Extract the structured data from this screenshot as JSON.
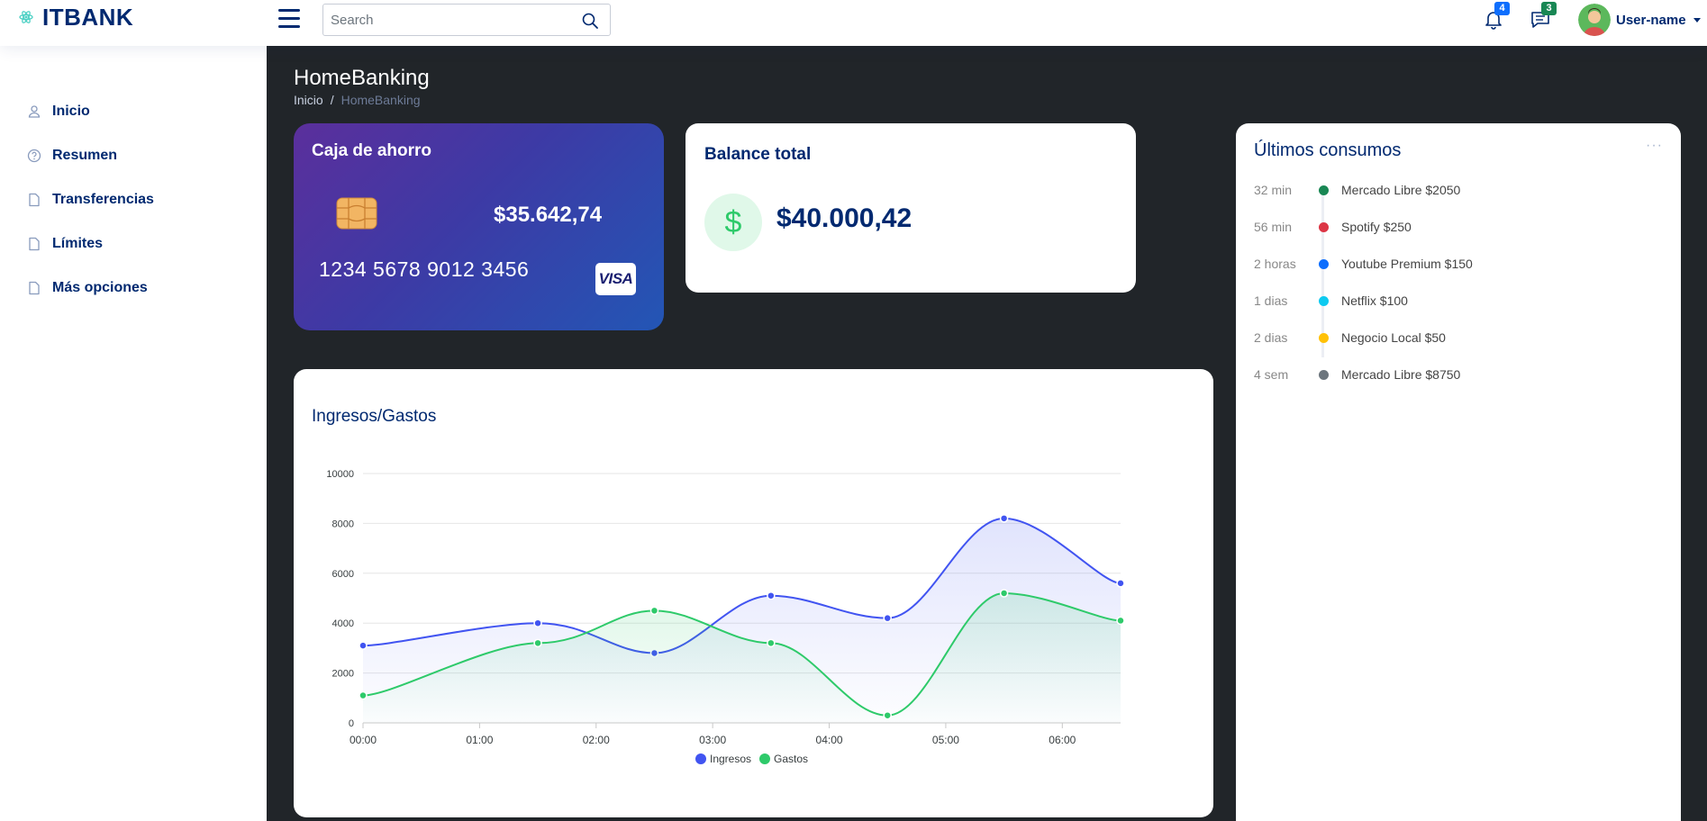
{
  "header": {
    "logo_text": "ITBANK",
    "search_placeholder": "Search",
    "notifications_count": "4",
    "messages_count": "3",
    "user_name": "User-name",
    "colors": {
      "brand": "#012970",
      "notif_badge": "#0d6efd",
      "msg_badge": "#198754"
    }
  },
  "sidebar": {
    "items": [
      {
        "label": "Inicio",
        "icon": "person-icon"
      },
      {
        "label": "Resumen",
        "icon": "question-circle-icon"
      },
      {
        "label": "Transferencias",
        "icon": "file-icon"
      },
      {
        "label": "Límites",
        "icon": "file-icon"
      },
      {
        "label": "Más opciones",
        "icon": "file-icon"
      }
    ]
  },
  "page": {
    "title": "HomeBanking",
    "breadcrumb": {
      "home": "Inicio",
      "separator": "/",
      "current": "HomeBanking"
    }
  },
  "account_card": {
    "title": "Caja de ahorro",
    "balance": "$35.642,74",
    "card_number": "1234 5678 9012 3456",
    "brand": "VISA"
  },
  "balance_card": {
    "title": "Balance total",
    "icon_symbol": "$",
    "amount": "$40.000,42"
  },
  "consumos": {
    "title": "Últimos consumos",
    "menu": "···",
    "items": [
      {
        "time": "32 min",
        "text": "Mercado Libre $2050",
        "color": "#198754"
      },
      {
        "time": "56 min",
        "text": "Spotify $250",
        "color": "#dc3545"
      },
      {
        "time": "2 horas",
        "text": "Youtube Premium $150",
        "color": "#0d6efd"
      },
      {
        "time": "1 dias",
        "text": "Netflix $100",
        "color": "#0dcaf0"
      },
      {
        "time": "2 dias",
        "text": "Negocio Local $50",
        "color": "#ffc107"
      },
      {
        "time": "4 sem",
        "text": "Mercado Libre $8750",
        "color": "#6c757d"
      }
    ]
  },
  "chart_data": {
    "type": "area",
    "title": "Ingresos/Gastos",
    "x_ticks": [
      "00:00",
      "01:00",
      "02:00",
      "03:00",
      "04:00",
      "05:00",
      "06:00"
    ],
    "x": [
      0,
      1.5,
      2.5,
      3.5,
      4.5,
      5.5,
      6.5
    ],
    "ylim": [
      0,
      10000
    ],
    "y_ticks": [
      0,
      2000,
      4000,
      6000,
      8000,
      10000
    ],
    "grid": true,
    "legend_position": "bottom",
    "series": [
      {
        "name": "Ingresos",
        "color": "#4154f1",
        "values": [
          3100,
          4000,
          2800,
          5100,
          4200,
          8200,
          5600
        ]
      },
      {
        "name": "Gastos",
        "color": "#2eca6a",
        "values": [
          1100,
          3200,
          4500,
          3200,
          300,
          5200,
          4100
        ]
      }
    ]
  }
}
